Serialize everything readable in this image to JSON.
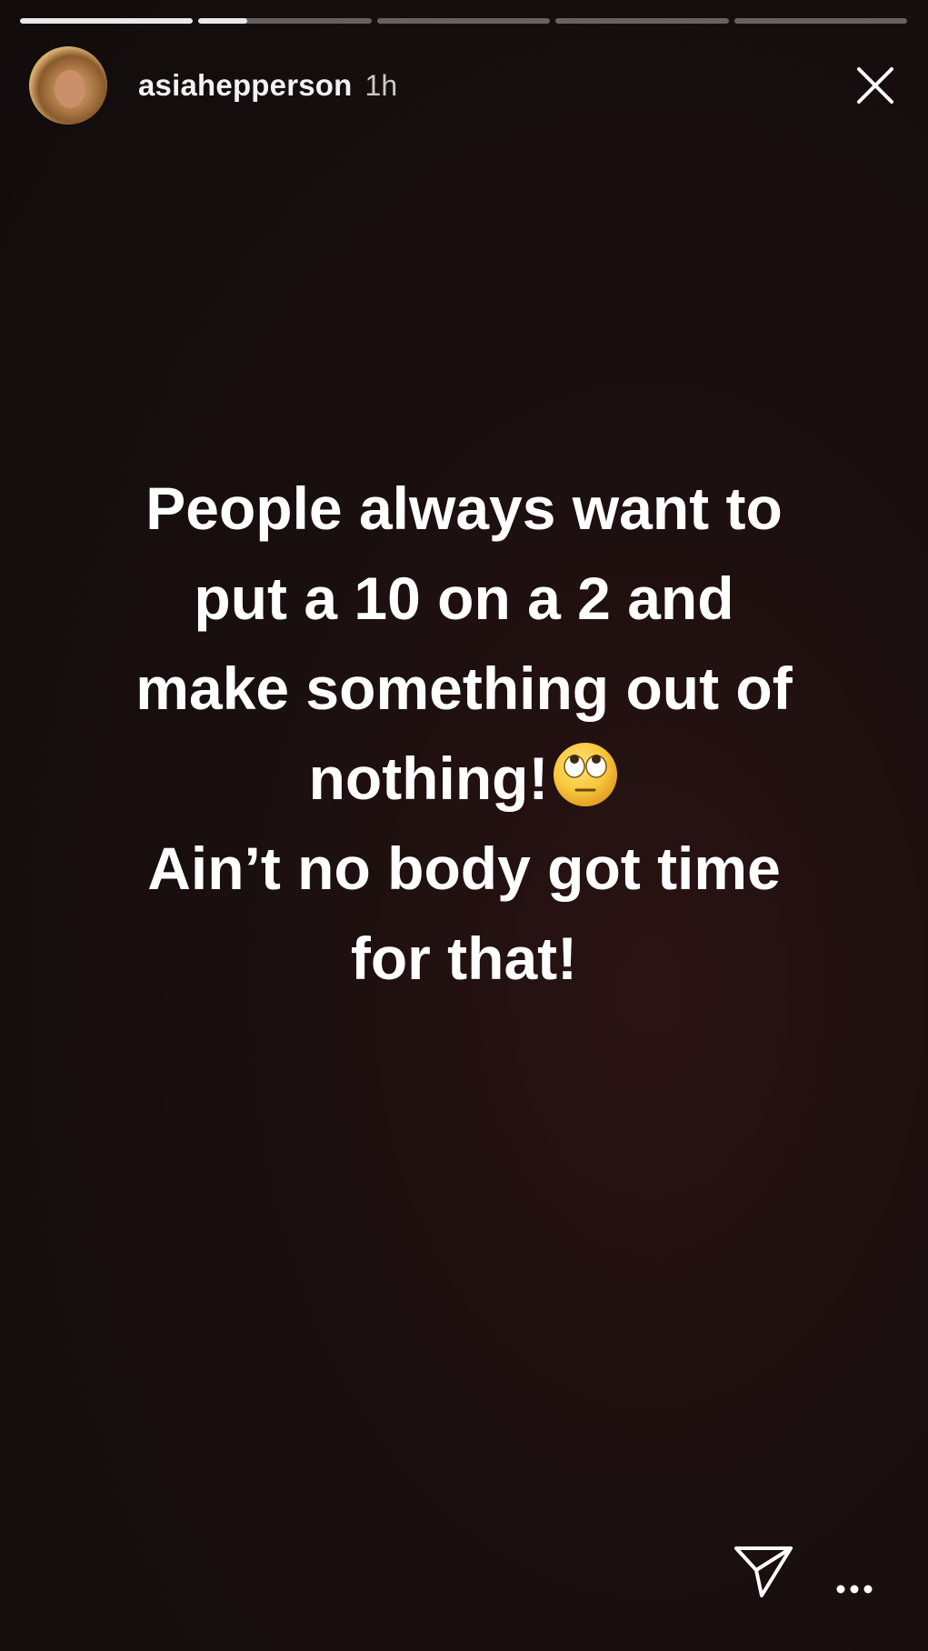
{
  "story": {
    "progress_segments": [
      {
        "progress": 1.0
      },
      {
        "progress": 0.28
      },
      {
        "progress": 0
      },
      {
        "progress": 0
      },
      {
        "progress": 0
      }
    ],
    "username": "asiahepperson",
    "time_ago": "1h",
    "message_lines": [
      "People always want to",
      "put a 10 on a 2 and",
      "make something out of",
      "nothing!",
      "Ain’t no body got time",
      "for that!"
    ],
    "emoji_name": "face-with-rolling-eyes",
    "colors": {
      "text": "#ffffff",
      "background": "#140d0d",
      "progress_fill": "#e9e9e9",
      "emoji_face": "#f7c63c"
    }
  }
}
